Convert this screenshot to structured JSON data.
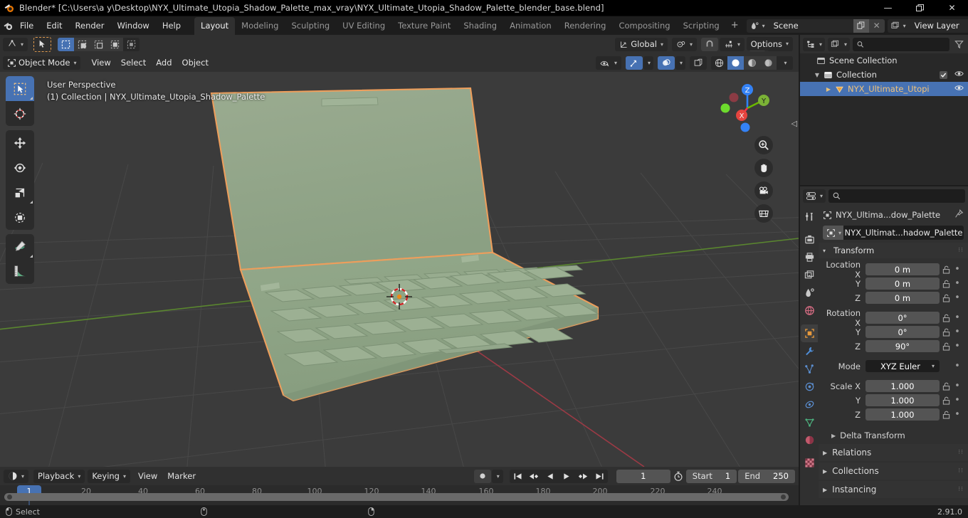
{
  "window": {
    "title": "Blender* [C:\\Users\\a y\\Desktop\\NYX_Ultimate_Utopia_Shadow_Palette_max_vray\\NYX_Ultimate_Utopia_Shadow_Palette_blender_base.blend]",
    "minimize": "—",
    "maximize": "❐",
    "close": "✕"
  },
  "topbar": {
    "menus": [
      "File",
      "Edit",
      "Render",
      "Window",
      "Help"
    ],
    "workspaces": [
      {
        "label": "Layout",
        "active": true
      },
      {
        "label": "Modeling",
        "active": false
      },
      {
        "label": "Sculpting",
        "active": false
      },
      {
        "label": "UV Editing",
        "active": false
      },
      {
        "label": "Texture Paint",
        "active": false
      },
      {
        "label": "Shading",
        "active": false
      },
      {
        "label": "Animation",
        "active": false
      },
      {
        "label": "Rendering",
        "active": false
      },
      {
        "label": "Compositing",
        "active": false
      },
      {
        "label": "Scripting",
        "active": false
      }
    ],
    "add_workspace": "+",
    "scene_name": "Scene",
    "view_layer_name": "View Layer"
  },
  "viewport": {
    "mode": "Object Mode",
    "menus": [
      "View",
      "Select",
      "Add",
      "Object"
    ],
    "transform_orientation": "Global",
    "options_label": "Options",
    "overlay_line1": "User Perspective",
    "overlay_line2": "(1) Collection | NYX_Ultimate_Utopia_Shadow_Palette",
    "gizmo_axes": [
      "X",
      "Y",
      "Z"
    ],
    "tools": [
      {
        "name": "tweak-tool",
        "active": true
      },
      {
        "name": "cursor-tool",
        "active": false
      },
      {
        "name": "move-tool",
        "active": false
      },
      {
        "name": "rotate-tool",
        "active": false
      },
      {
        "name": "scale-tool",
        "active": false
      },
      {
        "name": "transform-tool",
        "active": false
      },
      {
        "name": "annotate-tool",
        "active": false
      },
      {
        "name": "measure-tool",
        "active": false
      }
    ],
    "nav_buttons": [
      "zoom-icon",
      "hand-icon",
      "camera-icon",
      "grid-icon"
    ]
  },
  "timeline": {
    "editor_menus": [
      "Playback",
      "Keying",
      "View",
      "Marker"
    ],
    "current_frame": "1",
    "start_label": "Start",
    "start_value": "1",
    "end_label": "End",
    "end_value": "250",
    "ruler_ticks": [
      "20",
      "40",
      "60",
      "80",
      "100",
      "120",
      "140",
      "160",
      "180",
      "200",
      "220",
      "240"
    ],
    "playhead_label": "1"
  },
  "outliner": {
    "search_placeholder": "",
    "rows": [
      {
        "label": "Scene Collection",
        "indent": 0,
        "icon": "collection-icon",
        "expand": "",
        "selected": false,
        "checkbox": false,
        "eye": false
      },
      {
        "label": "Collection",
        "indent": 1,
        "icon": "collection-icon",
        "expand": "▼",
        "selected": false,
        "checkbox": true,
        "eye": true
      },
      {
        "label": "NYX_Ultimate_Utopi",
        "indent": 2,
        "icon": "mesh-icon",
        "expand": "▶",
        "selected": true,
        "checkbox": false,
        "eye": true
      }
    ]
  },
  "properties": {
    "breadcrumb_object": "NYX_Ultima...dow_Palette",
    "object_id_name": "NYX_Ultimat...hadow_Palette",
    "tabs": [
      {
        "name": "tool-tab",
        "active": false
      },
      {
        "name": "render-tab",
        "active": false
      },
      {
        "name": "output-tab",
        "active": false
      },
      {
        "name": "view-layer-tab",
        "active": false
      },
      {
        "name": "scene-tab",
        "active": false
      },
      {
        "name": "world-tab",
        "active": false
      },
      {
        "name": "object-tab",
        "active": true
      },
      {
        "name": "modifier-tab",
        "active": false
      },
      {
        "name": "particles-tab",
        "active": false
      },
      {
        "name": "physics-tab",
        "active": false
      },
      {
        "name": "constraints-tab",
        "active": false
      },
      {
        "name": "object-data-tab",
        "active": false
      },
      {
        "name": "material-tab",
        "active": false
      },
      {
        "name": "texture-tab",
        "active": false
      }
    ],
    "transform_title": "Transform",
    "fields": [
      {
        "label": "Location X",
        "value": "0 m"
      },
      {
        "label": "Y",
        "value": "0 m"
      },
      {
        "label": "Z",
        "value": "0 m"
      },
      {
        "label": "Rotation X",
        "value": "0°"
      },
      {
        "label": "Y",
        "value": "0°"
      },
      {
        "label": "Z",
        "value": "90°"
      },
      {
        "label": "Scale X",
        "value": "1.000"
      },
      {
        "label": "Y",
        "value": "1.000"
      },
      {
        "label": "Z",
        "value": "1.000"
      }
    ],
    "mode_label": "Mode",
    "mode_value": "XYZ Euler",
    "delta_transform": "Delta Transform",
    "panels": [
      "Relations",
      "Collections",
      "Instancing"
    ]
  },
  "statusbar": {
    "select_label": "Select",
    "version": "2.91.0"
  },
  "colors": {
    "accent_blue": "#4772b3",
    "accent_orange": "#ed9e5c",
    "object_green": "#8fa686",
    "viewport_bg": "#3b3b3b",
    "panel_bg": "#303030",
    "editor_bg": "#282828",
    "axis_x_red": "#fc2f47",
    "axis_y_green": "#6bb700",
    "axis_z_blue": "#2f82fc"
  }
}
